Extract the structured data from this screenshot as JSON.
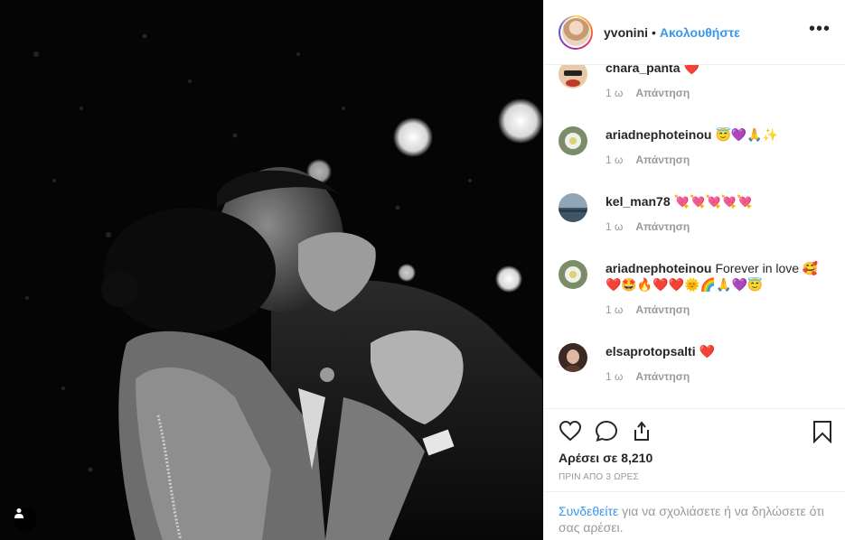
{
  "post": {
    "owner": "yvonini",
    "follow_label": "Ακολουθήστε",
    "separator": "•",
    "more_label": "•••"
  },
  "comments": [
    {
      "username": "chara_panta",
      "text": "❤️",
      "time": "1 ω",
      "reply_label": "Απάντηση"
    },
    {
      "username": "ariadnephoteinou",
      "text": "😇💜🙏✨",
      "time": "1 ω",
      "reply_label": "Απάντηση"
    },
    {
      "username": "kel_man78",
      "text": "💘💘💘💘💘",
      "time": "1 ω",
      "reply_label": "Απάντηση"
    },
    {
      "username": "ariadnephoteinou",
      "text": "Forever in love 🥰 ❤️🤩🔥❤️❤️🌞🌈🙏💜😇",
      "time": "1 ω",
      "reply_label": "Απάντηση"
    },
    {
      "username": "elsaprotopsalti",
      "text": "❤️",
      "time": "1 ω",
      "reply_label": "Απάντηση"
    }
  ],
  "actions": {
    "like_icon": "heart-outline-icon",
    "comment_icon": "comment-bubble-icon",
    "share_icon": "share-icon",
    "save_icon": "bookmark-icon"
  },
  "likes_text": "Αρέσει σε 8,210",
  "timestamp": "ΠΡΙΝ ΑΠΟ 3 ΩΡΕΣ",
  "login_prompt": {
    "link": "Συνδεθείτε",
    "rest": " για να σχολιάσετε ή να δηλώσετε ότι σας αρέσει."
  },
  "colors": {
    "link_blue": "#3897f0",
    "text": "#262626",
    "muted": "#999999",
    "border": "#efefef"
  }
}
